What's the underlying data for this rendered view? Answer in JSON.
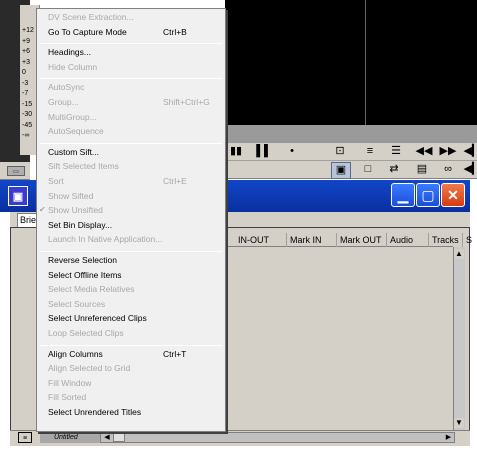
{
  "meter": {
    "labels": [
      "+12",
      "+9",
      "+6",
      "+3",
      "0",
      "-3",
      "-7",
      "-15",
      "-30",
      "-45",
      "-∞"
    ]
  },
  "toolbar": {
    "row1": [
      "▮▮",
      "▌▌",
      "•",
      "⊡",
      "≡",
      "☰",
      "◀◀",
      "▶▶",
      "◀▎"
    ],
    "row2": [
      "▣",
      "□",
      "⇄",
      "▤",
      "∞",
      "◀▎"
    ]
  },
  "bin": {
    "tab": "Brief",
    "columns": [
      "IN-OUT",
      "Mark IN",
      "Mark OUT",
      "Audio SR",
      "Tracks",
      "S"
    ],
    "status_field": "Untitled"
  },
  "menu": {
    "groups": [
      {
        "items": [
          {
            "label": "DV Scene Extraction...",
            "shortcut": "",
            "disabled": true
          },
          {
            "label": "Go To Capture Mode",
            "shortcut": "Ctrl+B",
            "disabled": false
          }
        ]
      },
      {
        "items": [
          {
            "label": "Headings...",
            "shortcut": "",
            "disabled": false
          },
          {
            "label": "Hide Column",
            "shortcut": "",
            "disabled": true
          }
        ]
      },
      {
        "items": [
          {
            "label": "AutoSync",
            "shortcut": "",
            "disabled": true
          },
          {
            "label": "Group...",
            "shortcut": "Shift+Ctrl+G",
            "disabled": true
          },
          {
            "label": "MultiGroup...",
            "shortcut": "",
            "disabled": true
          },
          {
            "label": "AutoSequence",
            "shortcut": "",
            "disabled": true
          }
        ]
      },
      {
        "items": [
          {
            "label": "Custom Sift...",
            "shortcut": "",
            "disabled": false
          },
          {
            "label": "Sift Selected Items",
            "shortcut": "",
            "disabled": true
          },
          {
            "label": "Sort",
            "shortcut": "Ctrl+E",
            "disabled": true
          },
          {
            "label": "Show Sifted",
            "shortcut": "",
            "disabled": true
          },
          {
            "label": "Show Unsifted",
            "shortcut": "",
            "disabled": true,
            "checked": true
          },
          {
            "label": "Set Bin Display...",
            "shortcut": "",
            "disabled": false
          },
          {
            "label": "Launch In Native Application...",
            "shortcut": "",
            "disabled": true
          }
        ]
      },
      {
        "items": [
          {
            "label": "Reverse Selection",
            "shortcut": "",
            "disabled": false
          },
          {
            "label": "Select Offline Items",
            "shortcut": "",
            "disabled": false
          },
          {
            "label": "Select Media Relatives",
            "shortcut": "",
            "disabled": true
          },
          {
            "label": "Select Sources",
            "shortcut": "",
            "disabled": true
          },
          {
            "label": "Select Unreferenced Clips",
            "shortcut": "",
            "disabled": false
          },
          {
            "label": "Loop Selected Clips",
            "shortcut": "",
            "disabled": true
          }
        ]
      },
      {
        "items": [
          {
            "label": "Align Columns",
            "shortcut": "Ctrl+T",
            "disabled": false
          },
          {
            "label": "Align Selected to Grid",
            "shortcut": "",
            "disabled": true
          },
          {
            "label": "Fill Window",
            "shortcut": "",
            "disabled": true
          },
          {
            "label": "Fill Sorted",
            "shortcut": "",
            "disabled": true
          },
          {
            "label": "Select Unrendered Titles",
            "shortcut": "",
            "disabled": false
          }
        ]
      }
    ]
  }
}
